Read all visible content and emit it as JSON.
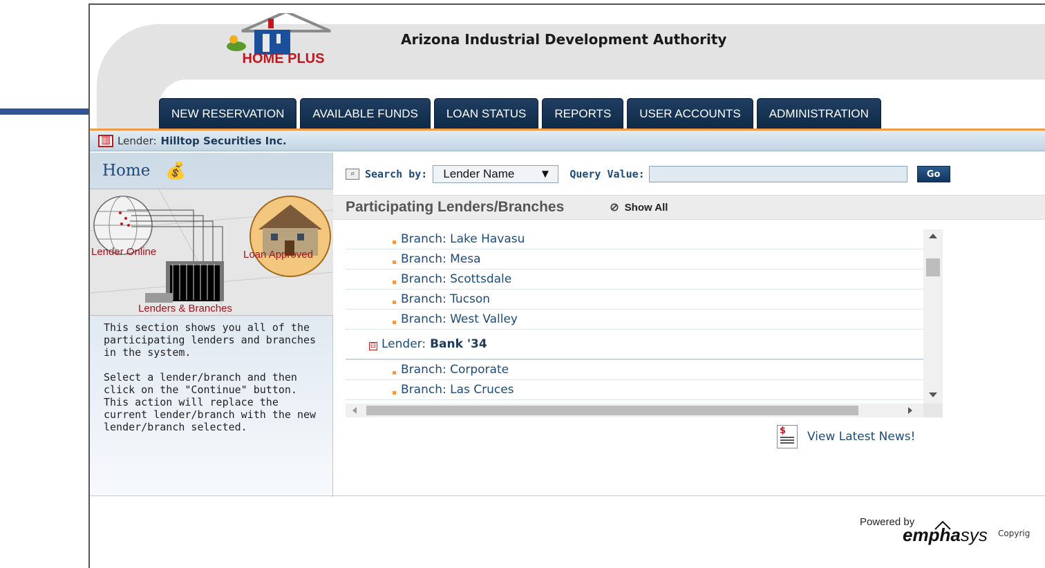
{
  "header": {
    "logo_text": "HOME PLUS",
    "title": "Arizona Industrial Development Authority"
  },
  "nav": {
    "tabs": [
      {
        "label": "NEW RESERVATION"
      },
      {
        "label": "AVAILABLE FUNDS"
      },
      {
        "label": "LOAN STATUS"
      },
      {
        "label": "REPORTS"
      },
      {
        "label": "USER ACCOUNTS"
      },
      {
        "label": "ADMINISTRATION"
      }
    ]
  },
  "lender_bar": {
    "label": "Lender:",
    "name": "Hilltop Securities Inc."
  },
  "sidebar": {
    "home_label": "Home",
    "illustration_labels": {
      "lender_online": "Lender Online",
      "loan_approved": "Loan Approved",
      "lenders_branches": "Lenders & Branches"
    },
    "desc_1": "This section shows you all of the participating lenders and branches in the system.",
    "desc_2": "Select a lender/branch and then click on the \"Continue\" button. This action will replace the current lender/branch with the new lender/branch selected."
  },
  "search": {
    "label": "Search by:",
    "selected": "Lender Name",
    "query_label": "Query Value:",
    "query_value": "",
    "go_label": "Go"
  },
  "list": {
    "title": "Participating Lenders/Branches",
    "show_all": "Show All",
    "rows": [
      {
        "type": "branch",
        "text": "Branch: Lake Havasu"
      },
      {
        "type": "branch",
        "text": "Branch: Mesa"
      },
      {
        "type": "branch",
        "text": "Branch: Scottsdale"
      },
      {
        "type": "branch",
        "text": "Branch: Tucson"
      },
      {
        "type": "branch",
        "text": "Branch: West Valley"
      },
      {
        "type": "lender",
        "prefix": "Lender:",
        "text": "Bank '34"
      },
      {
        "type": "branch",
        "text": "Branch: Corporate"
      },
      {
        "type": "branch",
        "text": "Branch: Las Cruces"
      }
    ]
  },
  "news_link": "View Latest News!",
  "footer": {
    "powered_by": "Powered by",
    "brand_bold": "empha",
    "brand_rest": "sys",
    "copyright": "Copyrig"
  },
  "colors": {
    "tab_bg": "#1f3e62",
    "accent_orange": "#f29a45",
    "link_blue": "#1d4a7a",
    "arrow_blue": "#2f5597"
  }
}
